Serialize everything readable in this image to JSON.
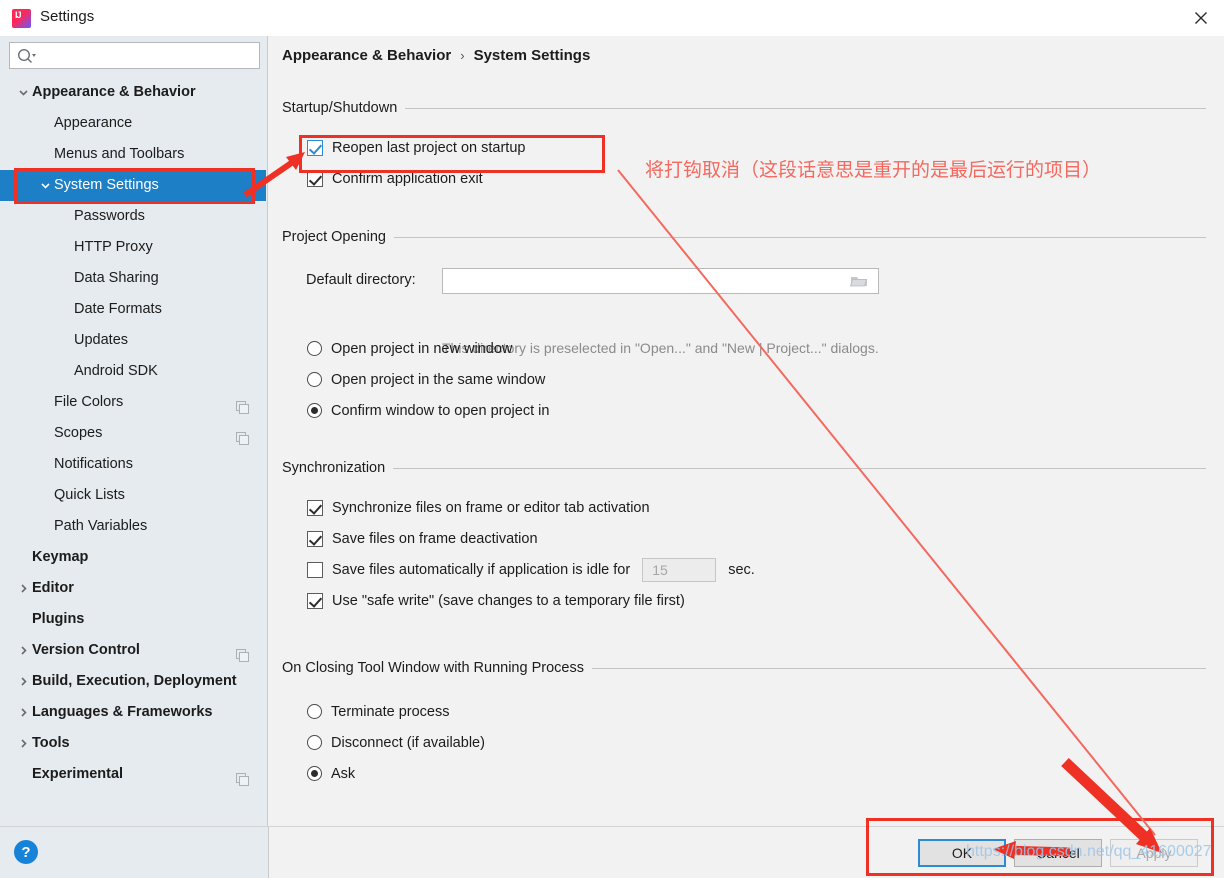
{
  "window": {
    "title": "Settings",
    "app_icon": "intellij-idea-logo",
    "close_icon": "close-icon"
  },
  "sidebar": {
    "search": {
      "value": "",
      "placeholder": "",
      "icon": "search-icon"
    },
    "items": [
      {
        "label": "Appearance & Behavior",
        "indent": 0,
        "bold": true,
        "twisty": "down",
        "selected": false,
        "copy": false
      },
      {
        "label": "Appearance",
        "indent": 1,
        "bold": false,
        "twisty": "none",
        "selected": false,
        "copy": false
      },
      {
        "label": "Menus and Toolbars",
        "indent": 1,
        "bold": false,
        "twisty": "none",
        "selected": false,
        "copy": false
      },
      {
        "label": "System Settings",
        "indent": 1,
        "bold": false,
        "twisty": "down",
        "selected": true,
        "copy": false
      },
      {
        "label": "Passwords",
        "indent": 2,
        "bold": false,
        "twisty": "none",
        "selected": false,
        "copy": false
      },
      {
        "label": "HTTP Proxy",
        "indent": 2,
        "bold": false,
        "twisty": "none",
        "selected": false,
        "copy": false
      },
      {
        "label": "Data Sharing",
        "indent": 2,
        "bold": false,
        "twisty": "none",
        "selected": false,
        "copy": false
      },
      {
        "label": "Date Formats",
        "indent": 2,
        "bold": false,
        "twisty": "none",
        "selected": false,
        "copy": false
      },
      {
        "label": "Updates",
        "indent": 2,
        "bold": false,
        "twisty": "none",
        "selected": false,
        "copy": false
      },
      {
        "label": "Android SDK",
        "indent": 2,
        "bold": false,
        "twisty": "none",
        "selected": false,
        "copy": false
      },
      {
        "label": "File Colors",
        "indent": 1,
        "bold": false,
        "twisty": "none",
        "selected": false,
        "copy": true
      },
      {
        "label": "Scopes",
        "indent": 1,
        "bold": false,
        "twisty": "none",
        "selected": false,
        "copy": true
      },
      {
        "label": "Notifications",
        "indent": 1,
        "bold": false,
        "twisty": "none",
        "selected": false,
        "copy": false
      },
      {
        "label": "Quick Lists",
        "indent": 1,
        "bold": false,
        "twisty": "none",
        "selected": false,
        "copy": false
      },
      {
        "label": "Path Variables",
        "indent": 1,
        "bold": false,
        "twisty": "none",
        "selected": false,
        "copy": false
      },
      {
        "label": "Keymap",
        "indent": 0,
        "bold": true,
        "twisty": "none",
        "selected": false,
        "copy": false
      },
      {
        "label": "Editor",
        "indent": 0,
        "bold": true,
        "twisty": "right",
        "selected": false,
        "copy": false
      },
      {
        "label": "Plugins",
        "indent": 0,
        "bold": true,
        "twisty": "none",
        "selected": false,
        "copy": false
      },
      {
        "label": "Version Control",
        "indent": 0,
        "bold": true,
        "twisty": "right",
        "selected": false,
        "copy": true
      },
      {
        "label": "Build, Execution, Deployment",
        "indent": 0,
        "bold": true,
        "twisty": "right",
        "selected": false,
        "copy": false
      },
      {
        "label": "Languages & Frameworks",
        "indent": 0,
        "bold": true,
        "twisty": "right",
        "selected": false,
        "copy": false
      },
      {
        "label": "Tools",
        "indent": 0,
        "bold": true,
        "twisty": "right",
        "selected": false,
        "copy": false
      },
      {
        "label": "Experimental",
        "indent": 0,
        "bold": true,
        "twisty": "none",
        "selected": false,
        "copy": true
      }
    ]
  },
  "breadcrumb": {
    "parent": "Appearance & Behavior",
    "separator": "›",
    "current": "System Settings"
  },
  "startup": {
    "section_title": "Startup/Shutdown",
    "reopen_label": "Reopen last project on startup",
    "reopen_checked": true,
    "confirm_exit_label": "Confirm application exit",
    "confirm_exit_checked": true
  },
  "project_opening": {
    "section_title": "Project Opening",
    "dir_label": "Default directory:",
    "dir_value": "",
    "dir_placeholder": "",
    "browse_icon": "folder-icon",
    "hint": "This directory is preselected in \"Open...\" and \"New | Project...\" dialogs.",
    "radios": [
      {
        "label": "Open project in new window",
        "selected": false
      },
      {
        "label": "Open project in the same window",
        "selected": false
      },
      {
        "label": "Confirm window to open project in",
        "selected": true
      }
    ]
  },
  "synchronization": {
    "section_title": "Synchronization",
    "options": [
      {
        "label": "Synchronize files on frame or editor tab activation",
        "checked": true,
        "has_field": false
      },
      {
        "label": "Save files on frame deactivation",
        "checked": true,
        "has_field": false
      },
      {
        "label": "Save files automatically if application is idle for",
        "checked": false,
        "has_field": true,
        "field_value": "15",
        "suffix": "sec."
      },
      {
        "label": "Use \"safe write\" (save changes to a temporary file first)",
        "checked": true,
        "has_field": false
      }
    ]
  },
  "closing_tool_window": {
    "section_title": "On Closing Tool Window with Running Process",
    "radios": [
      {
        "label": "Terminate process",
        "selected": false
      },
      {
        "label": "Disconnect (if available)",
        "selected": false
      },
      {
        "label": "Ask",
        "selected": true
      }
    ]
  },
  "bottom": {
    "help_icon": "help-icon",
    "help_label": "?",
    "ok_label": "OK",
    "cancel_label": "Cancel",
    "apply_label": "Apply"
  },
  "annotations": {
    "note_text": "将打钩取消（这段话意思是重开的是最后运行的项目）",
    "box_color": "#ee3124",
    "note_color": "#f4685e"
  },
  "watermark": {
    "text": "https://blog.csdn.net/qq_41600027"
  }
}
